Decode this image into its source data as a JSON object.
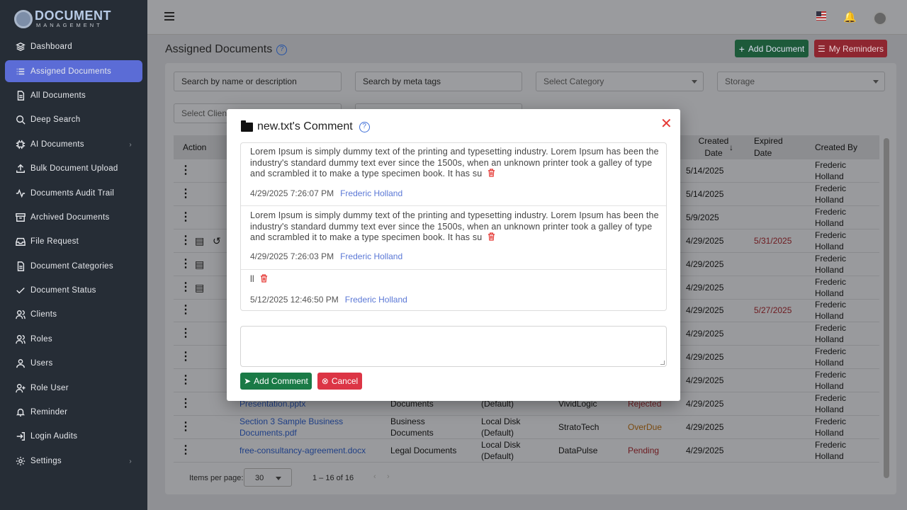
{
  "brand": {
    "line1": "DOCUMENT",
    "line2": "MANAGEMENT"
  },
  "nav": [
    {
      "label": "Dashboard",
      "icon": "layers-icon"
    },
    {
      "label": "Assigned Documents",
      "icon": "list-icon",
      "active": true
    },
    {
      "label": "All Documents",
      "icon": "file-icon"
    },
    {
      "label": "Deep Search",
      "icon": "search-icon"
    },
    {
      "label": "AI Documents",
      "icon": "chip-icon",
      "chevron": true
    },
    {
      "label": "Bulk Document Upload",
      "icon": "upload-icon"
    },
    {
      "label": "Documents Audit Trail",
      "icon": "activity-icon"
    },
    {
      "label": "Archived Documents",
      "icon": "archive-icon"
    },
    {
      "label": "File Request",
      "icon": "inbox-icon"
    },
    {
      "label": "Document Categories",
      "icon": "file-icon"
    },
    {
      "label": "Document Status",
      "icon": "check-icon"
    },
    {
      "label": "Clients",
      "icon": "users-icon"
    },
    {
      "label": "Roles",
      "icon": "users-icon"
    },
    {
      "label": "Users",
      "icon": "user-icon"
    },
    {
      "label": "Role User",
      "icon": "user-plus-icon"
    },
    {
      "label": "Reminder",
      "icon": "bell-icon"
    },
    {
      "label": "Login Audits",
      "icon": "login-icon"
    },
    {
      "label": "Settings",
      "icon": "gear-icon",
      "chevron": true
    }
  ],
  "page": {
    "title": "Assigned Documents",
    "add_document": "Add Document",
    "my_reminders": "My Reminders"
  },
  "filters": {
    "search_name": "Search by name or description",
    "search_meta": "Search by meta tags",
    "category": "Select Category",
    "storage": "Storage",
    "client": "Select Client"
  },
  "table": {
    "headers": {
      "action": "Action",
      "created": "Created Date",
      "expired": "Expired Date",
      "created_by": "Created By"
    },
    "rows": [
      {
        "created": "5/14/2025",
        "expired": "",
        "by": "Frederic Holland",
        "icons": 0
      },
      {
        "created": "5/14/2025",
        "expired": "",
        "by": "Frederic Holland",
        "icons": 0
      },
      {
        "created": "5/9/2025",
        "expired": "",
        "by": "Frederic Holland",
        "icons": 0
      },
      {
        "created": "4/29/2025",
        "expired": "5/31/2025",
        "by": "Frederic Holland",
        "icons": 2
      },
      {
        "created": "4/29/2025",
        "expired": "",
        "by": "Frederic Holland",
        "icons": 1
      },
      {
        "created": "4/29/2025",
        "expired": "",
        "by": "Frederic Holland",
        "icons": 1
      },
      {
        "created": "4/29/2025",
        "expired": "5/27/2025",
        "by": "Frederic Holland",
        "icons": 0
      },
      {
        "created": "4/29/2025",
        "expired": "",
        "by": "Frederic Holland",
        "icons": 0
      },
      {
        "created": "4/29/2025",
        "expired": "",
        "by": "Frederic Holland",
        "icons": 0
      },
      {
        "created": "4/29/2025",
        "expired": "",
        "by": "Frederic Holland",
        "icons": 0
      },
      {
        "name": "Presentation.pptx",
        "category": "Documents",
        "storage": "(Default)",
        "client": "VividLogic",
        "status": "Rejected",
        "created": "4/29/2025",
        "expired": "",
        "by": "Frederic Holland",
        "icons": 0
      },
      {
        "name": "Section 3 Sample Business Documents.pdf",
        "category": "Business Documents",
        "storage": "Local Disk (Default)",
        "client": "StratoTech",
        "status": "OverDue",
        "created": "4/29/2025",
        "expired": "",
        "by": "Frederic Holland",
        "icons": 0
      },
      {
        "name": "free-consultancy-agreement.docx",
        "category": "Legal Documents",
        "storage": "Local Disk (Default)",
        "client": "DataPulse",
        "status": "Pending",
        "created": "4/29/2025",
        "expired": "",
        "by": "Frederic Holland",
        "icons": 0
      }
    ]
  },
  "paginator": {
    "label": "Items per page:",
    "size": "30",
    "range": "1 – 16 of 16"
  },
  "modal": {
    "title": "new.txt's Comment",
    "comments": [
      {
        "text": "Lorem Ipsum is simply dummy text of the printing and typesetting industry. Lorem Ipsum has been the industry's standard dummy text ever since the 1500s, when an unknown printer took a galley of type and scrambled it to make a type specimen book. It has su",
        "date": "4/29/2025 7:26:07 PM",
        "author": "Frederic Holland"
      },
      {
        "text": "Lorem Ipsum is simply dummy text of the printing and typesetting industry. Lorem Ipsum has been the industry's standard dummy text ever since the 1500s, when an unknown printer took a galley of type and scrambled it to make a type specimen book. It has su",
        "date": "4/29/2025 7:26:03 PM",
        "author": "Frederic Holland"
      },
      {
        "text": "ll",
        "date": "5/12/2025 12:46:50 PM",
        "author": "Frederic Holland"
      }
    ],
    "add_comment": "Add Comment",
    "cancel": "Cancel"
  }
}
